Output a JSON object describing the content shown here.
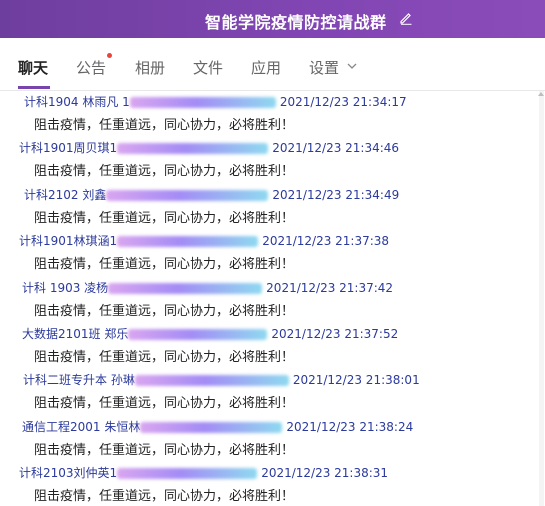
{
  "window": {
    "title": "智能学院疫情防控请战群",
    "edit_icon": "pencil-icon"
  },
  "tabs": [
    {
      "label": "聊天",
      "active": true
    },
    {
      "label": "公告",
      "badge": "red-dot"
    },
    {
      "label": "相册"
    },
    {
      "label": "文件"
    },
    {
      "label": "应用"
    },
    {
      "label": "设置",
      "icon": "chevron-down-icon"
    }
  ],
  "colors": {
    "title_bar": "#7a44ad",
    "sender_text": "#2b3a9b",
    "accent": "#7a44ad",
    "badge": "#e8453c"
  },
  "messages": [
    {
      "sender": "计科1904 林雨凡 1",
      "time": "2021/12/23 21:34:17",
      "text": "阻击疫情，任重道远，同心协力，必将胜利！"
    },
    {
      "sender": "计科1901周贝琪1",
      "time": "2021/12/23 21:34:46",
      "text": "阻击疫情，任重道远，同心协力，必将胜利！"
    },
    {
      "sender": "计科2102 刘鑫",
      "time": "2021/12/23 21:34:49",
      "text": "阻击疫情，任重道远，同心协力，必将胜利！"
    },
    {
      "sender": "计科1901林琪涵1",
      "time": "2021/12/23 21:37:38",
      "text": "阻击疫情，任重道远，同心协力，必将胜利！"
    },
    {
      "sender": "计科 1903 凌杨",
      "time": "2021/12/23 21:37:42",
      "text": "阻击疫情，任重道远，同心协力，必将胜利！"
    },
    {
      "sender": "大数据2101班 郑乐",
      "time": "2021/12/23 21:37:52",
      "text": "阻击疫情，任重道远，同心协力，必将胜利！"
    },
    {
      "sender": "计科二班专升本  孙琳",
      "time": "2021/12/23 21:38:01",
      "text": "阻击疫情，任重道远，同心协力，必将胜利！"
    },
    {
      "sender": "通信工程2001  朱恒林",
      "time": "2021/12/23 21:38:24",
      "text": "阻击疫情，任重道远，同心协力，必将胜利！"
    },
    {
      "sender": "计科2103刘仲英1",
      "time": "2021/12/23 21:38:31",
      "text": "阻击疫情，任重道远，同心协力，必将胜利！"
    }
  ]
}
